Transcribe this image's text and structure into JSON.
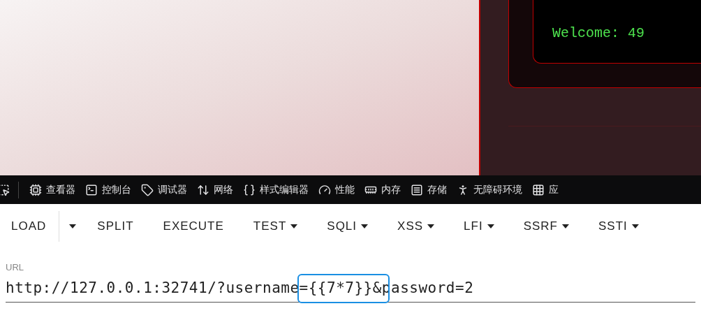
{
  "page": {
    "terminal_text": "Welcome: 49"
  },
  "devtools": {
    "tabs": [
      {
        "kind": "inspector",
        "label": "查看器"
      },
      {
        "kind": "console",
        "label": "控制台"
      },
      {
        "kind": "debugger",
        "label": "调试器"
      },
      {
        "kind": "network",
        "label": "网络"
      },
      {
        "kind": "style",
        "label": "样式编辑器"
      },
      {
        "kind": "performance",
        "label": "性能"
      },
      {
        "kind": "memory",
        "label": "内存"
      },
      {
        "kind": "storage",
        "label": "存储"
      },
      {
        "kind": "accessibility",
        "label": "无障碍环境"
      },
      {
        "kind": "apps",
        "label": "应"
      }
    ]
  },
  "hackbar": {
    "buttons": [
      {
        "label": "LOAD",
        "has_menu": false
      },
      {
        "label": "SPLIT",
        "has_menu": false
      },
      {
        "label": "EXECUTE",
        "has_menu": false
      },
      {
        "label": "TEST",
        "has_menu": true
      },
      {
        "label": "SQLI",
        "has_menu": true
      },
      {
        "label": "XSS",
        "has_menu": true
      },
      {
        "label": "LFI",
        "has_menu": true
      },
      {
        "label": "SSRF",
        "has_menu": true
      },
      {
        "label": "SSTI",
        "has_menu": true
      }
    ],
    "url_field": {
      "label": "URL",
      "value": "http://127.0.0.1:32741/?username={{7*7}}&password=2"
    }
  }
}
